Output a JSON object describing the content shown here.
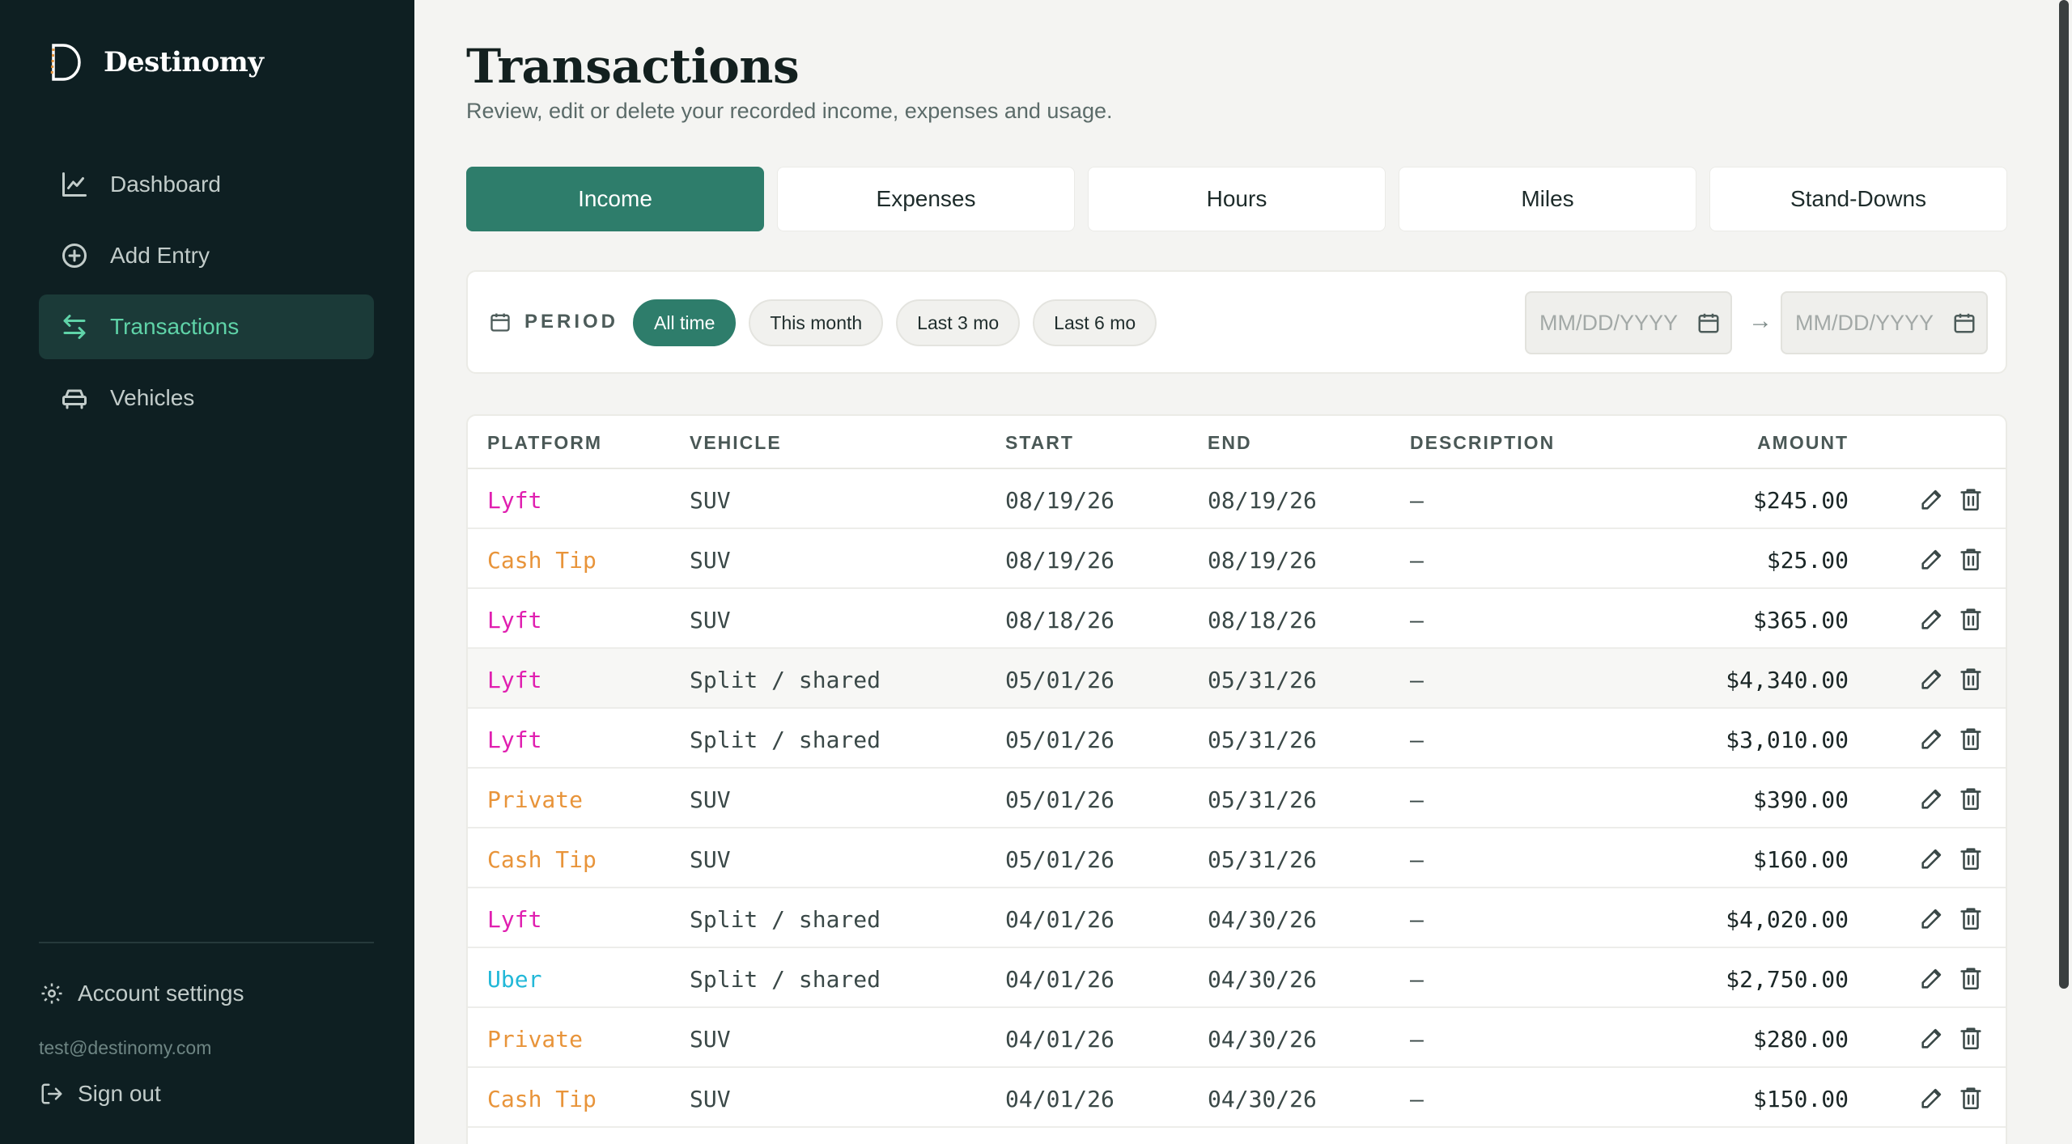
{
  "brand": {
    "name": "Destinomy"
  },
  "sidebar": {
    "items": [
      {
        "label": "Dashboard",
        "icon": "chart-line-icon"
      },
      {
        "label": "Add Entry",
        "icon": "plus-circle-icon"
      },
      {
        "label": "Transactions",
        "icon": "arrows-swap-icon",
        "active": true
      },
      {
        "label": "Vehicles",
        "icon": "car-icon"
      }
    ],
    "account_settings": "Account settings",
    "email": "test@destinomy.com",
    "sign_out": "Sign out"
  },
  "page": {
    "title": "Transactions",
    "subtitle": "Review, edit or delete your recorded income, expenses and usage."
  },
  "tabs": [
    {
      "label": "Income",
      "active": true
    },
    {
      "label": "Expenses"
    },
    {
      "label": "Hours"
    },
    {
      "label": "Miles"
    },
    {
      "label": "Stand-Downs"
    }
  ],
  "filter": {
    "label": "PERIOD",
    "chips": [
      {
        "label": "All time",
        "active": true
      },
      {
        "label": "This month"
      },
      {
        "label": "Last 3 mo"
      },
      {
        "label": "Last 6 mo"
      }
    ],
    "date_from_placeholder": "MM/DD/YYYY",
    "date_to_placeholder": "MM/DD/YYYY",
    "arrow": "→"
  },
  "table": {
    "headers": {
      "platform": "PLATFORM",
      "vehicle": "VEHICLE",
      "start": "START",
      "end": "END",
      "description": "DESCRIPTION",
      "amount": "AMOUNT"
    },
    "platform_colors": {
      "Lyft": "#e020b0",
      "Cash Tip": "#e8943a",
      "Private": "#e8943a",
      "Uber": "#22b8d8"
    },
    "rows": [
      {
        "platform": "Lyft",
        "vehicle": "SUV",
        "start": "08/19/26",
        "end": "08/19/26",
        "description": "—",
        "amount": "$245.00"
      },
      {
        "platform": "Cash Tip",
        "vehicle": "SUV",
        "start": "08/19/26",
        "end": "08/19/26",
        "description": "—",
        "amount": "$25.00"
      },
      {
        "platform": "Lyft",
        "vehicle": "SUV",
        "start": "08/18/26",
        "end": "08/18/26",
        "description": "—",
        "amount": "$365.00"
      },
      {
        "platform": "Lyft",
        "vehicle": "Split / shared",
        "start": "05/01/26",
        "end": "05/31/26",
        "description": "—",
        "amount": "$4,340.00",
        "highlighted": true
      },
      {
        "platform": "Lyft",
        "vehicle": "Split / shared",
        "start": "05/01/26",
        "end": "05/31/26",
        "description": "—",
        "amount": "$3,010.00"
      },
      {
        "platform": "Private",
        "vehicle": "SUV",
        "start": "05/01/26",
        "end": "05/31/26",
        "description": "—",
        "amount": "$390.00"
      },
      {
        "platform": "Cash Tip",
        "vehicle": "SUV",
        "start": "05/01/26",
        "end": "05/31/26",
        "description": "—",
        "amount": "$160.00"
      },
      {
        "platform": "Lyft",
        "vehicle": "Split / shared",
        "start": "04/01/26",
        "end": "04/30/26",
        "description": "—",
        "amount": "$4,020.00"
      },
      {
        "platform": "Uber",
        "vehicle": "Split / shared",
        "start": "04/01/26",
        "end": "04/30/26",
        "description": "—",
        "amount": "$2,750.00"
      },
      {
        "platform": "Private",
        "vehicle": "SUV",
        "start": "04/01/26",
        "end": "04/30/26",
        "description": "—",
        "amount": "$280.00"
      },
      {
        "platform": "Cash Tip",
        "vehicle": "SUV",
        "start": "04/01/26",
        "end": "04/30/26",
        "description": "—",
        "amount": "$150.00"
      }
    ]
  },
  "colors": {
    "accent": "#2e7d6b",
    "sidebar_bg": "#0e1f22",
    "active_nav_text": "#5fd3a8"
  }
}
